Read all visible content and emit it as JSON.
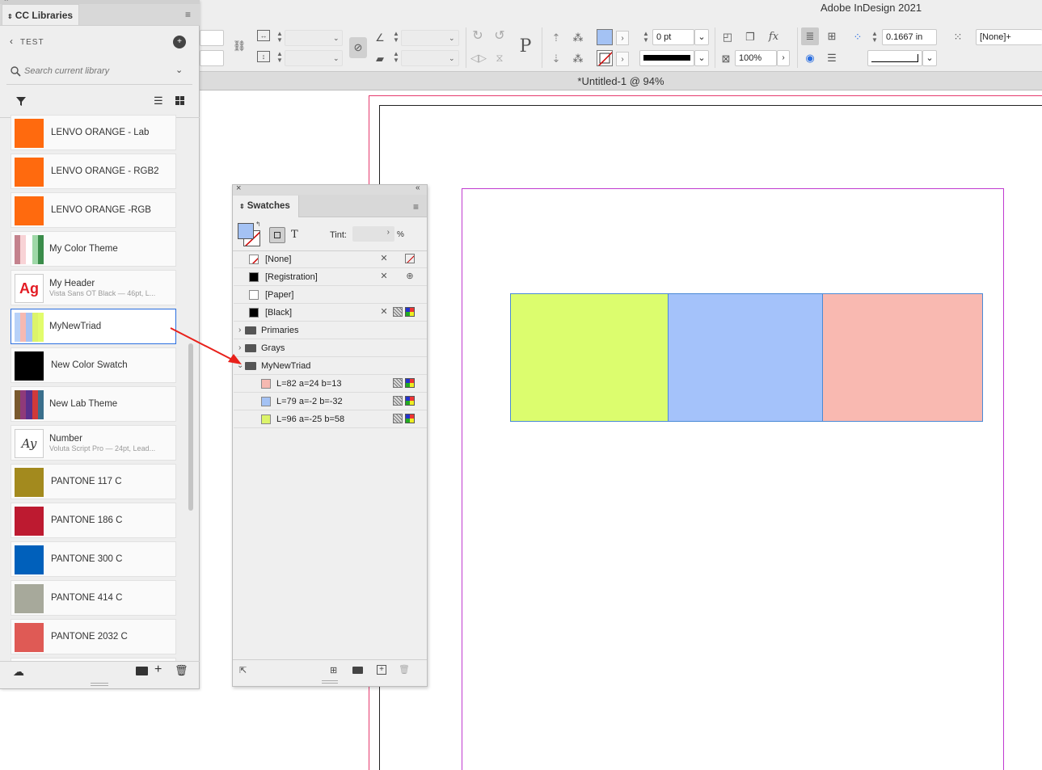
{
  "app": {
    "title": "Adobe InDesign 2021"
  },
  "document": {
    "tab_title": "*Untitled-1 @ 94%"
  },
  "control_panel": {
    "stroke_weight": "0 pt",
    "opacity": "100%",
    "offset_value": "0.1667 in",
    "object_style": "[None]+",
    "colors": {
      "fill": "#a4c2f4",
      "stroke": "#cc0000"
    }
  },
  "cc_libraries": {
    "panel_title": "CC Libraries",
    "library_name": "TEST",
    "search_placeholder": "Search current library",
    "items": [
      {
        "label": "LENVO ORANGE - Lab",
        "sub": "",
        "kind": "color",
        "colors": [
          "#ff6a0e"
        ]
      },
      {
        "label": "LENVO ORANGE - RGB2",
        "sub": "",
        "kind": "color",
        "colors": [
          "#ff6a0e"
        ]
      },
      {
        "label": "LENVO ORANGE -RGB",
        "sub": "",
        "kind": "color",
        "colors": [
          "#ff6a0e"
        ]
      },
      {
        "label": "My Color Theme",
        "sub": "",
        "kind": "theme",
        "colors": [
          "#c4828d",
          "#f8d3d6",
          "#ffffff",
          "#9fd8a8",
          "#3a8c4a"
        ]
      },
      {
        "label": "My Header",
        "sub": "Vista Sans OT Black — 46pt, L...",
        "kind": "text",
        "glyph": "Ag"
      },
      {
        "label": "MyNewTriad",
        "sub": "",
        "kind": "theme",
        "colors": [
          "#b7d1f8",
          "#f6b9b1",
          "#a4c2f4",
          "#dcf46a",
          "#e2fc6c"
        ]
      },
      {
        "label": "New Color Swatch",
        "sub": "",
        "kind": "color",
        "colors": [
          "#000000"
        ]
      },
      {
        "label": "New Lab Theme",
        "sub": "",
        "kind": "theme",
        "colors": [
          "#7a5a2e",
          "#8f3a7a",
          "#5a2f8c",
          "#d03a3a",
          "#3a6f8c"
        ]
      },
      {
        "label": "Number",
        "sub": "Voluta Script Pro — 24pt, Lead...",
        "kind": "script",
        "glyph": "Ay"
      },
      {
        "label": "PANTONE 117 C",
        "sub": "",
        "kind": "color",
        "colors": [
          "#a38a1e"
        ]
      },
      {
        "label": "PANTONE 186 C",
        "sub": "",
        "kind": "color",
        "colors": [
          "#bd1a30"
        ]
      },
      {
        "label": "PANTONE 300 C",
        "sub": "",
        "kind": "color",
        "colors": [
          "#0060bb"
        ]
      },
      {
        "label": "PANTONE 414 C",
        "sub": "",
        "kind": "color",
        "colors": [
          "#a7a99b"
        ]
      },
      {
        "label": "PANTONE 2032 C",
        "sub": "",
        "kind": "color",
        "colors": [
          "#df5a55"
        ]
      }
    ]
  },
  "swatches": {
    "title": "Swatches",
    "tint_label": "Tint:",
    "tint_unit": "%",
    "text_toggle": "T",
    "rows": [
      {
        "label": "[None]",
        "chip": "none"
      },
      {
        "label": "[Registration]",
        "chip": "#000000"
      },
      {
        "label": "[Paper]",
        "chip": "#ffffff"
      },
      {
        "label": "[Black]",
        "chip": "#000000"
      },
      {
        "label": "Primaries",
        "chip": "folder"
      },
      {
        "label": "Grays",
        "chip": "folder"
      },
      {
        "label": "MyNewTriad",
        "chip": "folder-open"
      },
      {
        "label": "L=82 a=24 b=13",
        "chip": "#f6b9b1"
      },
      {
        "label": "L=79 a=-2 b=-32",
        "chip": "#a4c2f4"
      },
      {
        "label": "L=96 a=-25 b=58",
        "chip": "#dcf46a"
      }
    ]
  },
  "canvas_blocks": [
    {
      "name": "lime-block",
      "color": "#dcfd6e"
    },
    {
      "name": "blue-block",
      "color": "#a4c2fa"
    },
    {
      "name": "pink-block",
      "color": "#f9b9b1"
    }
  ]
}
